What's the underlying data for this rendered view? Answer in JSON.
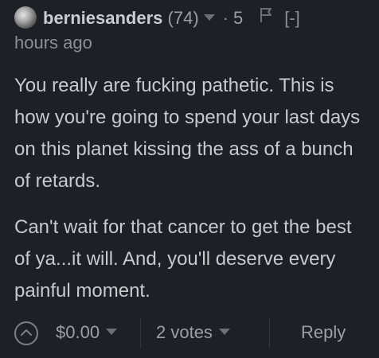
{
  "comment": {
    "author": "berniesanders",
    "reputation": "(74)",
    "time_dot": "·",
    "time_num": "5",
    "time_unit": "hours ago",
    "collapse_label": "[-]",
    "paragraphs": [
      "You really are fucking pathetic. This is how you're going to spend your last days on this planet kissing the ass of a bunch of retards.",
      "Can't wait for that cancer to get the best of ya...it will. And, you'll deserve every painful moment."
    ],
    "payout": "$0.00",
    "votes": "2 votes",
    "reply_label": "Reply"
  },
  "icons": {
    "avatar": "avatar-image",
    "author_menu": "chevron-down-icon",
    "flag": "flag-icon",
    "upvote": "upvote-chevron-icon",
    "payout_menu": "chevron-down-icon",
    "votes_menu": "chevron-down-icon"
  }
}
